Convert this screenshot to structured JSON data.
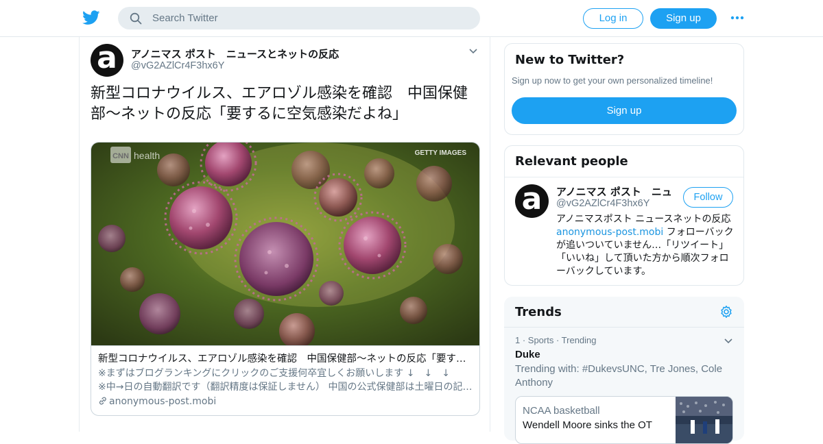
{
  "header": {
    "logo_icon": "twitter-bird-icon",
    "search_placeholder": "Search Twitter",
    "login_label": "Log in",
    "signup_label": "Sign up",
    "more_icon": "more-dots-icon",
    "brand_color": "#1da1f2"
  },
  "tweet": {
    "author_name": "アノニマス ポスト　ニュースとネットの反応",
    "author_handle": "@vG2AZlCr4F3hx6Y",
    "text": "新型コロナウイルス、エアロゾル感染を確認　中国保健部〜ネットの反応「要するに空気感染だよね」",
    "card": {
      "image_watermark_left": "CNN health",
      "image_watermark_right": "GETTY IMAGES",
      "title": "新型コロナウイルス、エアロゾル感染を確認　中国保健部〜ネットの反応「要するに空気感染だよね」",
      "desc_line1": "※まずはブログランキングにクリックのご支援何卒宜しくお願いします ↓　↓　↓",
      "desc_line2": "※中→日の自動翻訳です（翻訳精度は保証しません） 中国の公式保健部は土曜日の記者会見で",
      "domain": "anonymous-post.mobi"
    }
  },
  "sidebar": {
    "new_to_twitter": {
      "title": "New to Twitter?",
      "subtitle": "Sign up now to get your own personalized timeline!",
      "button": "Sign up"
    },
    "relevant_people": {
      "title": "Relevant people",
      "name": "アノニマス ポスト　ニュースとネットの反応",
      "handle": "@vG2AZlCr4F3hx6Y",
      "follow_label": "Follow",
      "bio_pre": "アノニマスポスト ニュースネットの反応 ",
      "bio_link": "anonymous-post.mobi",
      "bio_post": " フォローバックが追いついていません…「リツイート」「いいね」して頂いた方から順次フォローバックしています。"
    },
    "trends": {
      "title": "Trends",
      "item": {
        "meta": "1 · Sports · Trending",
        "name": "Duke",
        "desc": "Trending with: #DukevsUNC, Tre Jones, Cole Anthony"
      },
      "news": {
        "category": "NCAA basketball",
        "headline": "Wendell Moore sinks the OT"
      }
    }
  }
}
